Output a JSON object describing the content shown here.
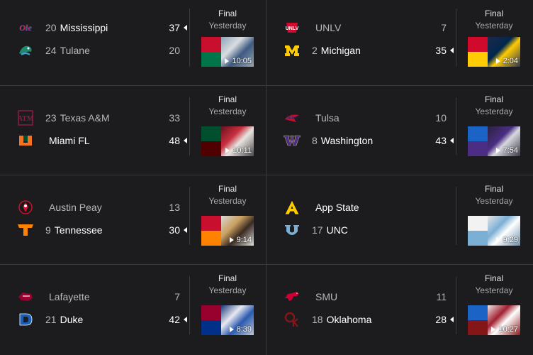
{
  "games": [
    {
      "status": "Final",
      "when": "Yesterday",
      "duration": "10:05",
      "team1": {
        "rank": "20",
        "name": "Mississippi",
        "score": "37",
        "logo": "ole-miss-logo",
        "winner": true
      },
      "team2": {
        "rank": "24",
        "name": "Tulane",
        "score": "20",
        "logo": "tulane-logo",
        "winner": false
      }
    },
    {
      "status": "Final",
      "when": "Yesterday",
      "duration": "2:04",
      "team1": {
        "rank": "",
        "name": "UNLV",
        "score": "7",
        "logo": "unlv-logo",
        "winner": false
      },
      "team2": {
        "rank": "2",
        "name": "Michigan",
        "score": "35",
        "logo": "michigan-logo",
        "winner": true
      }
    },
    {
      "status": "Final",
      "when": "Yesterday",
      "duration": "10:11",
      "team1": {
        "rank": "23",
        "name": "Texas A&M",
        "score": "33",
        "logo": "texas-am-logo",
        "winner": false
      },
      "team2": {
        "rank": "",
        "name": "Miami FL",
        "score": "48",
        "logo": "miami-logo",
        "winner": true
      }
    },
    {
      "status": "Final",
      "when": "Yesterday",
      "duration": "7:54",
      "team1": {
        "rank": "",
        "name": "Tulsa",
        "score": "10",
        "logo": "tulsa-logo",
        "winner": false
      },
      "team2": {
        "rank": "8",
        "name": "Washington",
        "score": "43",
        "logo": "washington-logo",
        "winner": true
      }
    },
    {
      "status": "Final",
      "when": "Yesterday",
      "duration": "9:14",
      "team1": {
        "rank": "",
        "name": "Austin Peay",
        "score": "13",
        "logo": "austin-peay-logo",
        "winner": false
      },
      "team2": {
        "rank": "9",
        "name": "Tennessee",
        "score": "30",
        "logo": "tennessee-logo",
        "winner": true
      }
    },
    {
      "status": "Final",
      "when": "Yesterday",
      "duration": "9:29",
      "team1": {
        "rank": "",
        "name": "App State",
        "score": "",
        "logo": "app-state-logo",
        "winner": false
      },
      "team2": {
        "rank": "17",
        "name": "UNC",
        "score": "",
        "logo": "unc-logo",
        "winner": false
      }
    },
    {
      "status": "Final",
      "when": "Yesterday",
      "duration": "8:39",
      "team1": {
        "rank": "",
        "name": "Lafayette",
        "score": "7",
        "logo": "lafayette-logo",
        "winner": false
      },
      "team2": {
        "rank": "21",
        "name": "Duke",
        "score": "42",
        "logo": "duke-logo",
        "winner": true
      }
    },
    {
      "status": "Final",
      "when": "Yesterday",
      "duration": "10:27",
      "team1": {
        "rank": "",
        "name": "SMU",
        "score": "11",
        "logo": "smu-logo",
        "winner": false
      },
      "team2": {
        "rank": "18",
        "name": "Oklahoma",
        "score": "28",
        "logo": "oklahoma-logo",
        "winner": true
      }
    }
  ]
}
